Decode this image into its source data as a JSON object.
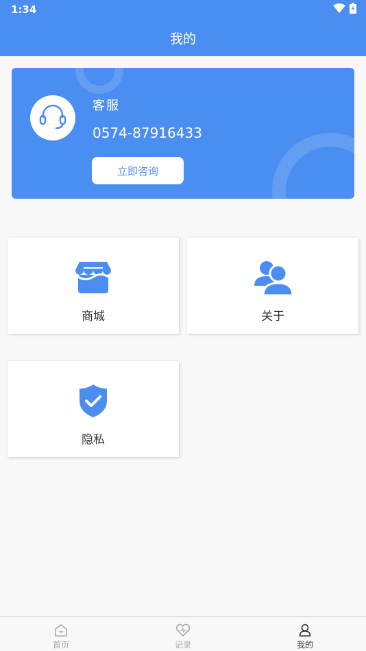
{
  "status_bar": {
    "time": "1:34",
    "icons": [
      "wifi-icon",
      "battery-icon"
    ]
  },
  "header": {
    "title": "我的"
  },
  "service_card": {
    "title": "客服",
    "phone": "0574-87916433",
    "button_label": "立即咨询",
    "icon": "headset-icon"
  },
  "menu": {
    "items": [
      {
        "label": "商城",
        "icon": "store-icon"
      },
      {
        "label": "关于",
        "icon": "users-icon"
      },
      {
        "label": "隐私",
        "icon": "shield-check-icon"
      }
    ]
  },
  "bottom_nav": {
    "items": [
      {
        "label": "首页",
        "icon": "home-icon",
        "active": false
      },
      {
        "label": "记录",
        "icon": "heart-icon",
        "active": false
      },
      {
        "label": "我的",
        "icon": "user-icon",
        "active": true
      }
    ]
  },
  "colors": {
    "primary": "#4a8ef2",
    "background": "#f8f8f8",
    "tile": "#ffffff"
  }
}
